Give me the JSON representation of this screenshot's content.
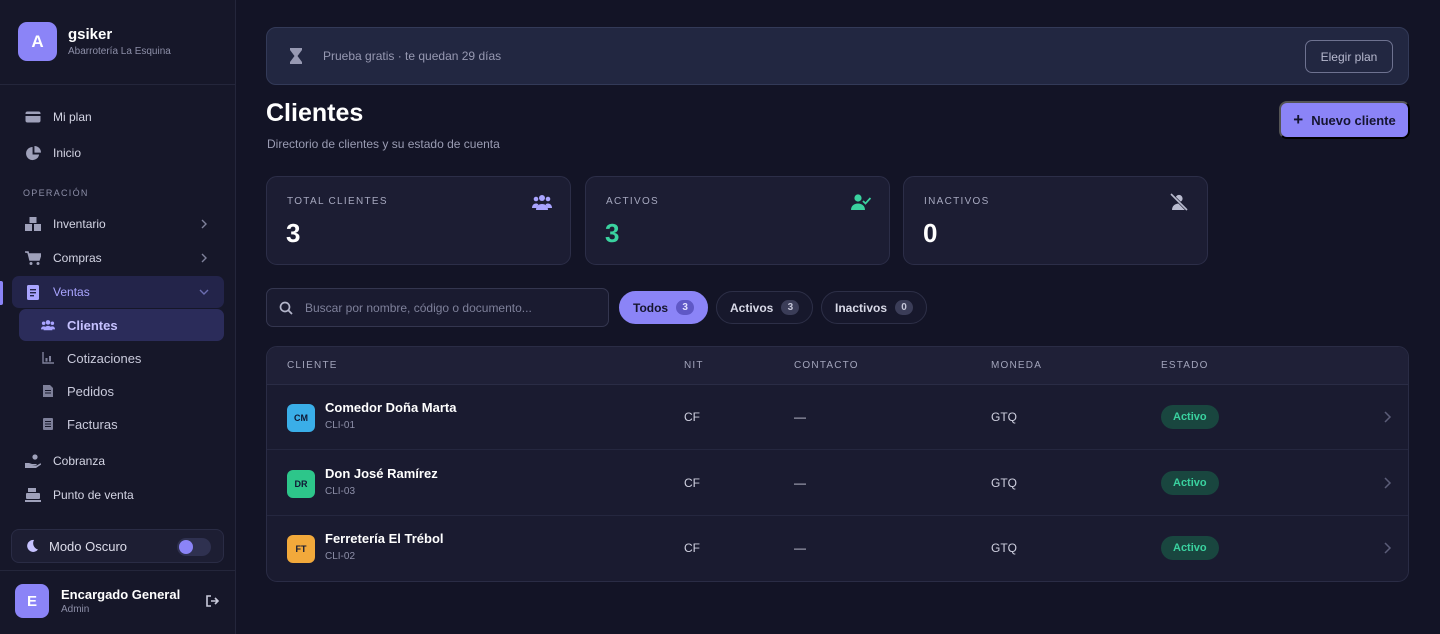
{
  "brand": {
    "initial": "A",
    "name": "gsiker",
    "subtitle": "Abarrotería La Esquina"
  },
  "sidebar": {
    "top_items": [
      {
        "label": "Mi plan",
        "icon": "card-icon"
      },
      {
        "label": "Inicio",
        "icon": "pie-icon"
      }
    ],
    "section_label": "OPERACIÓN",
    "items": [
      {
        "label": "Inventario",
        "icon": "boxes-icon"
      },
      {
        "label": "Compras",
        "icon": "cart-icon"
      },
      {
        "label": "Ventas",
        "icon": "receipt-icon"
      }
    ],
    "ventas_sub": [
      {
        "label": "Clientes",
        "icon": "users-icon"
      },
      {
        "label": "Cotizaciones",
        "icon": "chart-icon"
      },
      {
        "label": "Pedidos",
        "icon": "document-icon"
      },
      {
        "label": "Facturas",
        "icon": "invoice-icon"
      }
    ],
    "bottom_items": [
      {
        "label": "Cobranza",
        "icon": "hand-coins-icon"
      },
      {
        "label": "Punto de venta",
        "icon": "register-icon"
      }
    ],
    "dark_mode_label": "Modo Oscuro"
  },
  "user": {
    "initial": "E",
    "name": "Encargado General",
    "role": "Admin"
  },
  "trial": {
    "text": "Prueba gratis · te quedan 29 días",
    "button": "Elegir plan"
  },
  "page": {
    "title": "Clientes",
    "subtitle": "Directorio de clientes y su estado de cuenta",
    "new_button": "Nuevo cliente"
  },
  "stats": [
    {
      "label": "TOTAL CLIENTES",
      "value": "3"
    },
    {
      "label": "ACTIVOS",
      "value": "3"
    },
    {
      "label": "INACTIVOS",
      "value": "0"
    }
  ],
  "search": {
    "placeholder": "Buscar por nombre, código o documento..."
  },
  "filters": [
    {
      "label": "Todos",
      "count": "3"
    },
    {
      "label": "Activos",
      "count": "3"
    },
    {
      "label": "Inactivos",
      "count": "0"
    }
  ],
  "table": {
    "headers": [
      "CLIENTE",
      "NIT",
      "CONTACTO",
      "MONEDA",
      "ESTADO"
    ],
    "rows": [
      {
        "initials": "CM",
        "name": "Comedor Doña Marta",
        "code": "CLI-01",
        "nit": "CF",
        "contact": "—",
        "currency": "GTQ",
        "status": "Activo",
        "color": "#3aaee8"
      },
      {
        "initials": "DR",
        "name": "Don José Ramírez",
        "code": "CLI-03",
        "nit": "CF",
        "contact": "—",
        "currency": "GTQ",
        "status": "Activo",
        "color": "#2dc68a"
      },
      {
        "initials": "FT",
        "name": "Ferretería El Trébol",
        "code": "CLI-02",
        "nit": "CF",
        "contact": "—",
        "currency": "GTQ",
        "status": "Activo",
        "color": "#f2a93b"
      }
    ]
  },
  "colors": {
    "accent": "#8b84f7",
    "success": "#3ad29f",
    "background": "#131426"
  }
}
